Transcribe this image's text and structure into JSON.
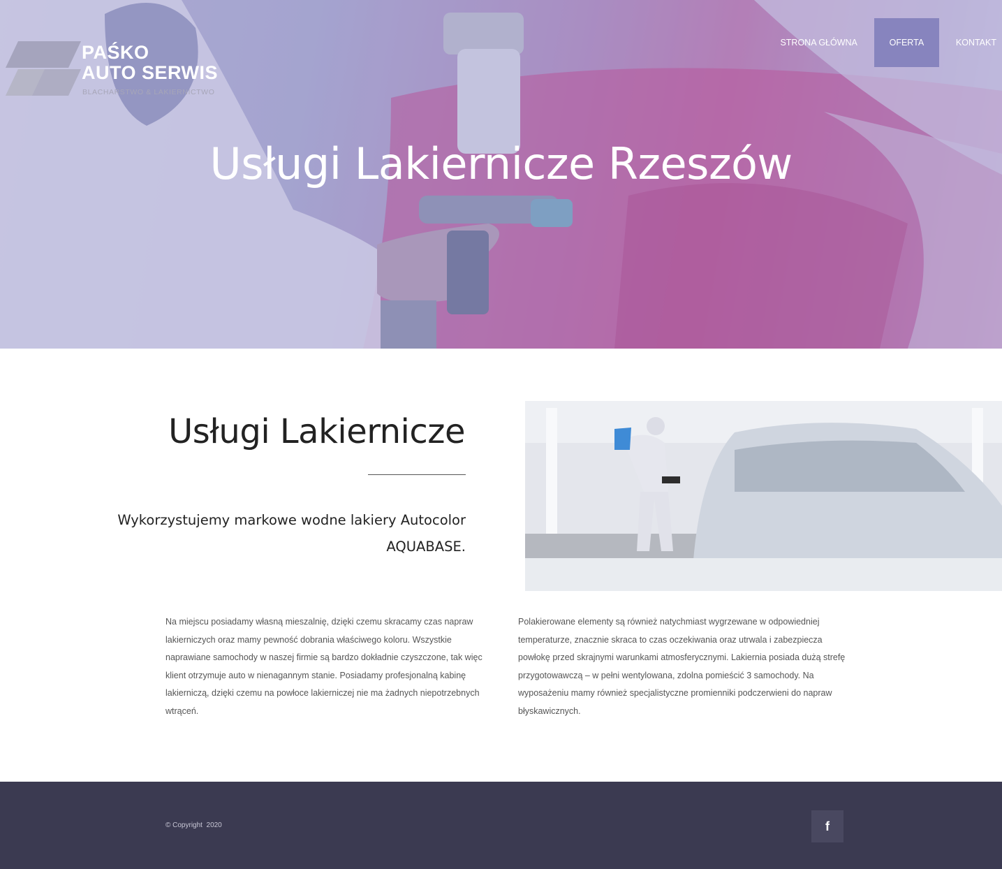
{
  "brand": {
    "name_line1": "PAŚKO",
    "name_line2": "AUTO SERWIS",
    "tagline": "BLACHARSTWO & LAKIERNICTWO"
  },
  "nav": {
    "items": [
      {
        "label": "STRONA GŁÓWNA",
        "active": false
      },
      {
        "label": "OFERTA",
        "active": true
      },
      {
        "label": "KONTAKT",
        "active": false
      }
    ]
  },
  "hero": {
    "title": "Usługi Lakiernicze Rzeszów"
  },
  "section": {
    "title": "Usługi Lakiernicze",
    "lead": "Wykorzystujemy markowe wodne lakiery Autocolor AQUABASE."
  },
  "body": {
    "left": "Na miejscu posiadamy własną mieszalnię, dzięki czemu skracamy czas napraw lakierniczych oraz mamy pewność dobrania właściwego koloru. Wszystkie naprawiane samochody w naszej firmie są bardzo dokładnie czyszczone, tak więc klient otrzymuje auto w nienagannym stanie. Posiadamy profesjonalną kabinę lakierniczą, dzięki czemu na powłoce lakierniczej nie ma żadnych niepotrzebnych wtrąceń.",
    "right": "Polakierowane elementy są również natychmiast wygrzewane w odpowiedniej temperaturze, znacznie skraca to czas oczekiwania oraz utrwala i zabezpiecza powłokę przed skrajnymi warunkami atmosferycznymi. Lakiernia posiada dużą strefę przygotowawczą – w pełni wentylowana, zdolna pomieścić 3 samochody. Na wyposażeniu mamy również specjalistyczne promienniki podczerwieni do napraw błyskawicznych."
  },
  "footer": {
    "copyright": "© Copyright  2020",
    "social_icon": "facebook-icon",
    "social_glyph": "f"
  },
  "colors": {
    "nav_active": "#8784be",
    "footer_bg": "#3b3a51",
    "social_bg": "#494860"
  }
}
